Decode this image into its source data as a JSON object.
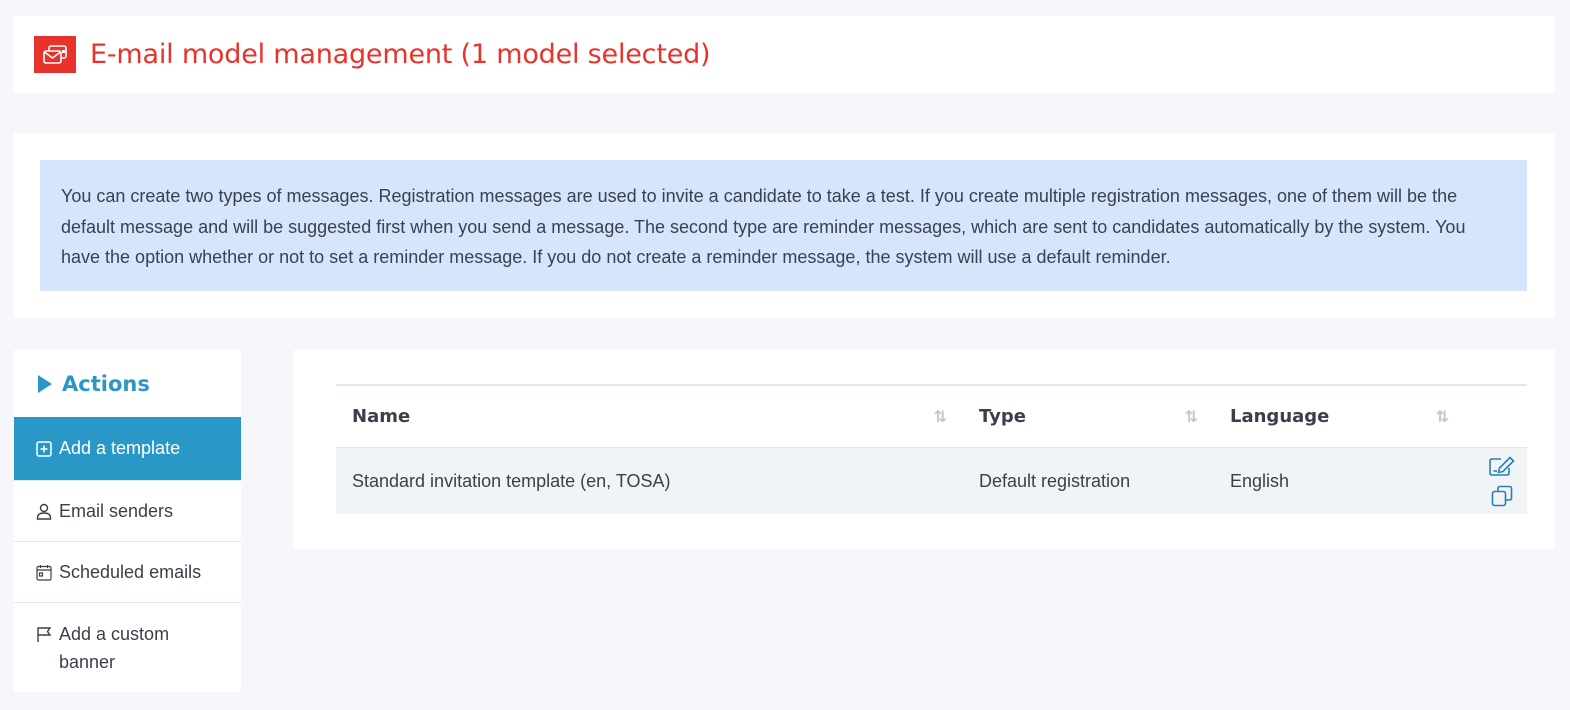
{
  "header": {
    "title": "E-mail model management (1 model selected)",
    "icon": "email-model-icon",
    "accent_color": "#e8332a"
  },
  "info": {
    "text": "You can create two types of messages. Registration messages are used to invite a candidate to take a test. If you create multiple registration messages, one of them will be the default message and will be suggested first when you send a message. The second type are reminder messages, which are sent to candidates automatically by the system. You have the option whether or not to set a reminder message. If you do not create a reminder message, the system will use a default reminder."
  },
  "sidebar": {
    "title": "Actions",
    "accent_color": "#2a98c6",
    "items": [
      {
        "label": "Add a template",
        "icon": "plus-square-icon",
        "active": true
      },
      {
        "label": "Email senders",
        "icon": "user-icon",
        "active": false
      },
      {
        "label": "Scheduled emails",
        "icon": "calendar-icon",
        "active": false
      },
      {
        "label": "Add a custom banner",
        "icon": "flag-icon",
        "active": false
      }
    ]
  },
  "table": {
    "columns": [
      {
        "label": "Name",
        "sortable": true
      },
      {
        "label": "Type",
        "sortable": true
      },
      {
        "label": "Language",
        "sortable": true
      }
    ],
    "rows": [
      {
        "name": "Standard invitation template (en, TOSA)",
        "type": "Default registration",
        "language": "English",
        "actions": [
          "edit-icon",
          "copy-icon"
        ]
      }
    ]
  }
}
